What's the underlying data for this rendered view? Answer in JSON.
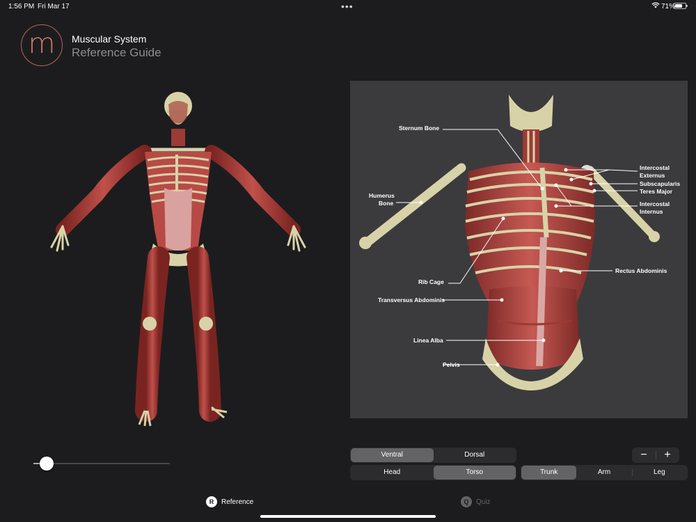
{
  "status": {
    "time": "1:56 PM",
    "date": "Fri Mar 17",
    "dots": "•••",
    "battery": "71%",
    "battery_level": 0.71
  },
  "header": {
    "logo": "m",
    "title": "Muscular System",
    "subtitle": "Reference Guide"
  },
  "diagram": {
    "labels": {
      "sternum": "Sternum  Bone",
      "humerus1": "Humerus",
      "humerus2": "Bone",
      "rib_cage": "Rib Cage",
      "transversus": "Transversus Abdominis",
      "linea_alba": "Linea Alba",
      "pelvis": "Pelvis",
      "intercostal_ext1": "Intercostal",
      "intercostal_ext2": "Externus",
      "subscapularis": "Subscapularis",
      "teres_major": "Teres Major",
      "intercostal_int1": "Intercostal",
      "intercostal_int2": "Internus",
      "rectus": "Rectus Abdominis"
    }
  },
  "slider": {
    "value": 0.1
  },
  "view_toggle": {
    "options": [
      "Ventral",
      "Dorsal"
    ],
    "selected": "Ventral"
  },
  "region_toggle": {
    "options": [
      "Head",
      "Torso"
    ],
    "selected": "Torso"
  },
  "part_toggle": {
    "options": [
      "Trunk",
      "Arm",
      "Leg"
    ],
    "selected": "Trunk"
  },
  "zoom": {
    "minus": "−",
    "plus": "+"
  },
  "tabs": [
    {
      "icon": "R",
      "label": "Reference"
    },
    {
      "icon": "Q",
      "label": "Quiz"
    }
  ],
  "colors": {
    "background": "#1c1c1e",
    "panel": "#3b3b3d",
    "accent": "#c97a6e",
    "muscle": "#b84a45",
    "bone": "#d8d2a8"
  }
}
